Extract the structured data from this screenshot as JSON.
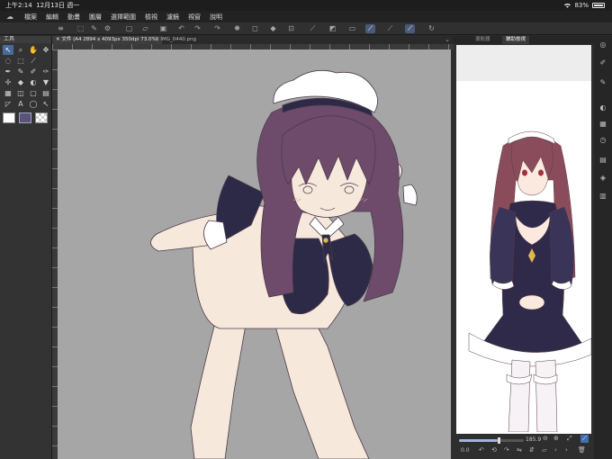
{
  "status": {
    "time": "上午2:14",
    "date": "12月13日 週一",
    "battery": "83%"
  },
  "menu": [
    "檔案",
    "編輯",
    "動畫",
    "圖層",
    "選擇範圍",
    "檢視",
    "濾鏡",
    "視窗",
    "說明"
  ],
  "tool_panel": {
    "title": "工具"
  },
  "tabs": {
    "active": "文件 (A4 2894 x 4093px 350dpi 73.0%)",
    "second": "IMG_0440.png"
  },
  "right_panel": {
    "tab1": "導航器",
    "tab2": "輔助檢視",
    "zoom": "185.9",
    "angle": "0.0"
  },
  "colors": {
    "bg": "#2b2b2b",
    "canvas": "#a6a6a6",
    "hair": "#6e4b6b",
    "skin": "#f7e8dc",
    "outfit": "#2d2a47",
    "accent": "#4a6a9a",
    "main_color": "#ffffff",
    "sub_color": "#5b5276"
  }
}
